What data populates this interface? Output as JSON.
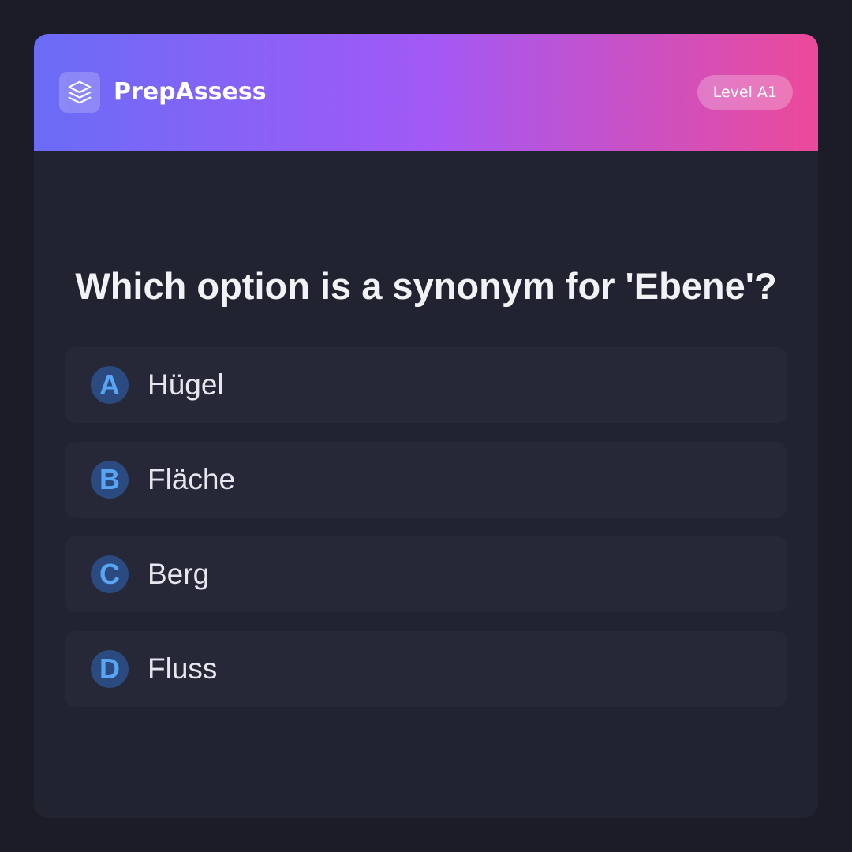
{
  "header": {
    "brand": "PrepAssess",
    "logo_icon": "layers-icon",
    "level": "Level A1",
    "gradient": [
      "#6a6cf6",
      "#a259f6",
      "#ec4a9a"
    ]
  },
  "question": {
    "text": "Which option is a synonym for 'Ebene'?"
  },
  "options": [
    {
      "letter": "A",
      "text": "Hügel"
    },
    {
      "letter": "B",
      "text": "Fläche"
    },
    {
      "letter": "C",
      "text": "Berg"
    },
    {
      "letter": "D",
      "text": "Fluss"
    }
  ],
  "colors": {
    "background": "#1b1c27",
    "card": "#212330",
    "option_bg": "#272837",
    "letter_bg": "#2b4a80",
    "letter_fg": "#5aa4f4"
  }
}
